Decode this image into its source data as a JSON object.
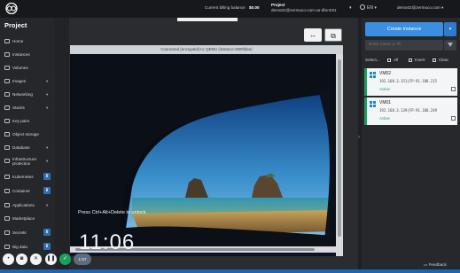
{
  "topbar": {
    "billing_label": "Current billing balance",
    "billing_value": "$0.00",
    "project_label": "Project",
    "project_value": "demo02@zermuco.com-us-dfw-E01",
    "language": "EN",
    "user_email": "demo02@zermuco.com"
  },
  "sidebar": {
    "title": "Project",
    "items": [
      {
        "label": "Home",
        "chevron": false,
        "download": false
      },
      {
        "label": "Instances",
        "chevron": false,
        "download": false
      },
      {
        "label": "Volumes",
        "chevron": false,
        "download": false
      },
      {
        "label": "Images",
        "chevron": true,
        "download": false
      },
      {
        "label": "Networking",
        "chevron": true,
        "download": false
      },
      {
        "label": "Stacks",
        "chevron": true,
        "download": false
      },
      {
        "label": "Key pairs",
        "chevron": false,
        "download": false
      },
      {
        "label": "Object storage",
        "chevron": false,
        "download": false
      },
      {
        "label": "Database",
        "chevron": true,
        "download": false
      },
      {
        "label": "Infrastructure protection",
        "chevron": true,
        "download": false
      },
      {
        "label": "Kubernetes",
        "chevron": false,
        "download": true
      },
      {
        "label": "Container",
        "chevron": false,
        "download": true
      },
      {
        "label": "Applications",
        "chevron": true,
        "download": false
      },
      {
        "label": "Marketplace",
        "chevron": false,
        "download": false
      },
      {
        "label": "Secrets",
        "chevron": false,
        "download": true
      },
      {
        "label": "Big data",
        "chevron": false,
        "download": true
      }
    ]
  },
  "controls": {
    "timer": "1:57"
  },
  "console": {
    "title": "Connected (encrypted) to: QEMU (instance-0000fdee)",
    "lock_hint": "Press Ctrl+Alt+Delete to unlock.",
    "clock": "11:06"
  },
  "right_panel": {
    "create_label": "Create instance",
    "search_placeholder": "Enter name or IP",
    "select_label": "Select...",
    "all_label": "All",
    "invert_label": "Invert",
    "clear_label": "Clear",
    "vms": [
      {
        "name": "VM02",
        "ip": "192.168.3.151|FP:91.108.215",
        "state": "Active"
      },
      {
        "name": "VM01",
        "ip": "192.168.3.139|FP:91.108.249",
        "state": "Active"
      }
    ],
    "feedback": "Feedback"
  },
  "colors": {
    "accent": "#3b8ee0",
    "active": "#1aa05c",
    "sky_top": "#1f6fb8",
    "sea": "#2f95b4"
  }
}
